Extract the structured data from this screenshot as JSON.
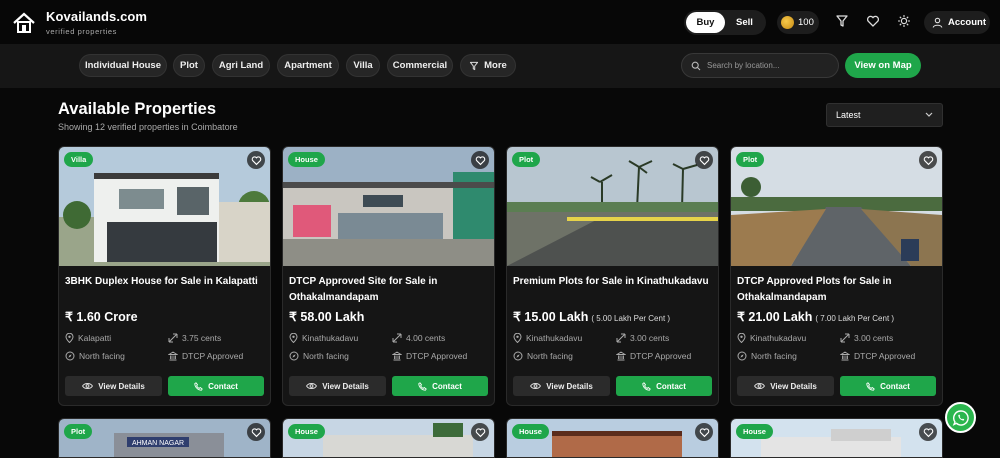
{
  "brand": {
    "name": "Kovailands.com",
    "tagline": "verified properties"
  },
  "header": {
    "mode_toggle": {
      "buy": "Buy",
      "sell": "Sell",
      "active": "Buy"
    },
    "coins": "100",
    "account_label": "Account"
  },
  "filters": {
    "chips": [
      "Individual House",
      "Plot",
      "Agri Land",
      "Apartment",
      "Villa",
      "Commercial"
    ],
    "more_label": "More",
    "search_placeholder": "Search by location...",
    "map_button": "View on Map"
  },
  "main": {
    "title": "Available Properties",
    "subtitle": "Showing 12 verified properties in Coimbatore",
    "sort_value": "Latest"
  },
  "buttons": {
    "view": "View Details",
    "contact": "Contact"
  },
  "listings": [
    {
      "badge": "Villa",
      "title": "3BHK Duplex House for Sale in Kalapatti",
      "price": "₹ 1.60 Crore",
      "price_note": "",
      "location": "Kalapatti",
      "area": "3.75 cents",
      "facing": "North facing",
      "approval": "DTCP Approved"
    },
    {
      "badge": "House",
      "title": "DTCP Approved Site for Sale in Othakalmandapam",
      "price": "₹ 58.00 Lakh",
      "price_note": "",
      "location": "Kinathukadavu",
      "area": "4.00 cents",
      "facing": "North facing",
      "approval": "DTCP Approved"
    },
    {
      "badge": "Plot",
      "title": "Premium Plots for Sale in Kinathukadavu",
      "price": "₹ 15.00 Lakh",
      "price_note": "( 5.00 Lakh Per Cent )",
      "location": "Kinathukadavu",
      "area": "3.00 cents",
      "facing": "North facing",
      "approval": "DTCP Approved"
    },
    {
      "badge": "Plot",
      "title": "DTCP Approved Plots for Sale in Othakalmandapam",
      "price": "₹ 21.00 Lakh",
      "price_note": "( 7.00 Lakh Per Cent )",
      "location": "Kinathukadavu",
      "area": "3.00 cents",
      "facing": "North facing",
      "approval": "DTCP Approved"
    }
  ],
  "next_row_badges": [
    "Plot",
    "House",
    "House",
    "House"
  ],
  "next_row_sign": "AHMAN NAGAR",
  "colors": {
    "accent": "#1fa64a",
    "background": "#080808",
    "card": "#151515"
  }
}
